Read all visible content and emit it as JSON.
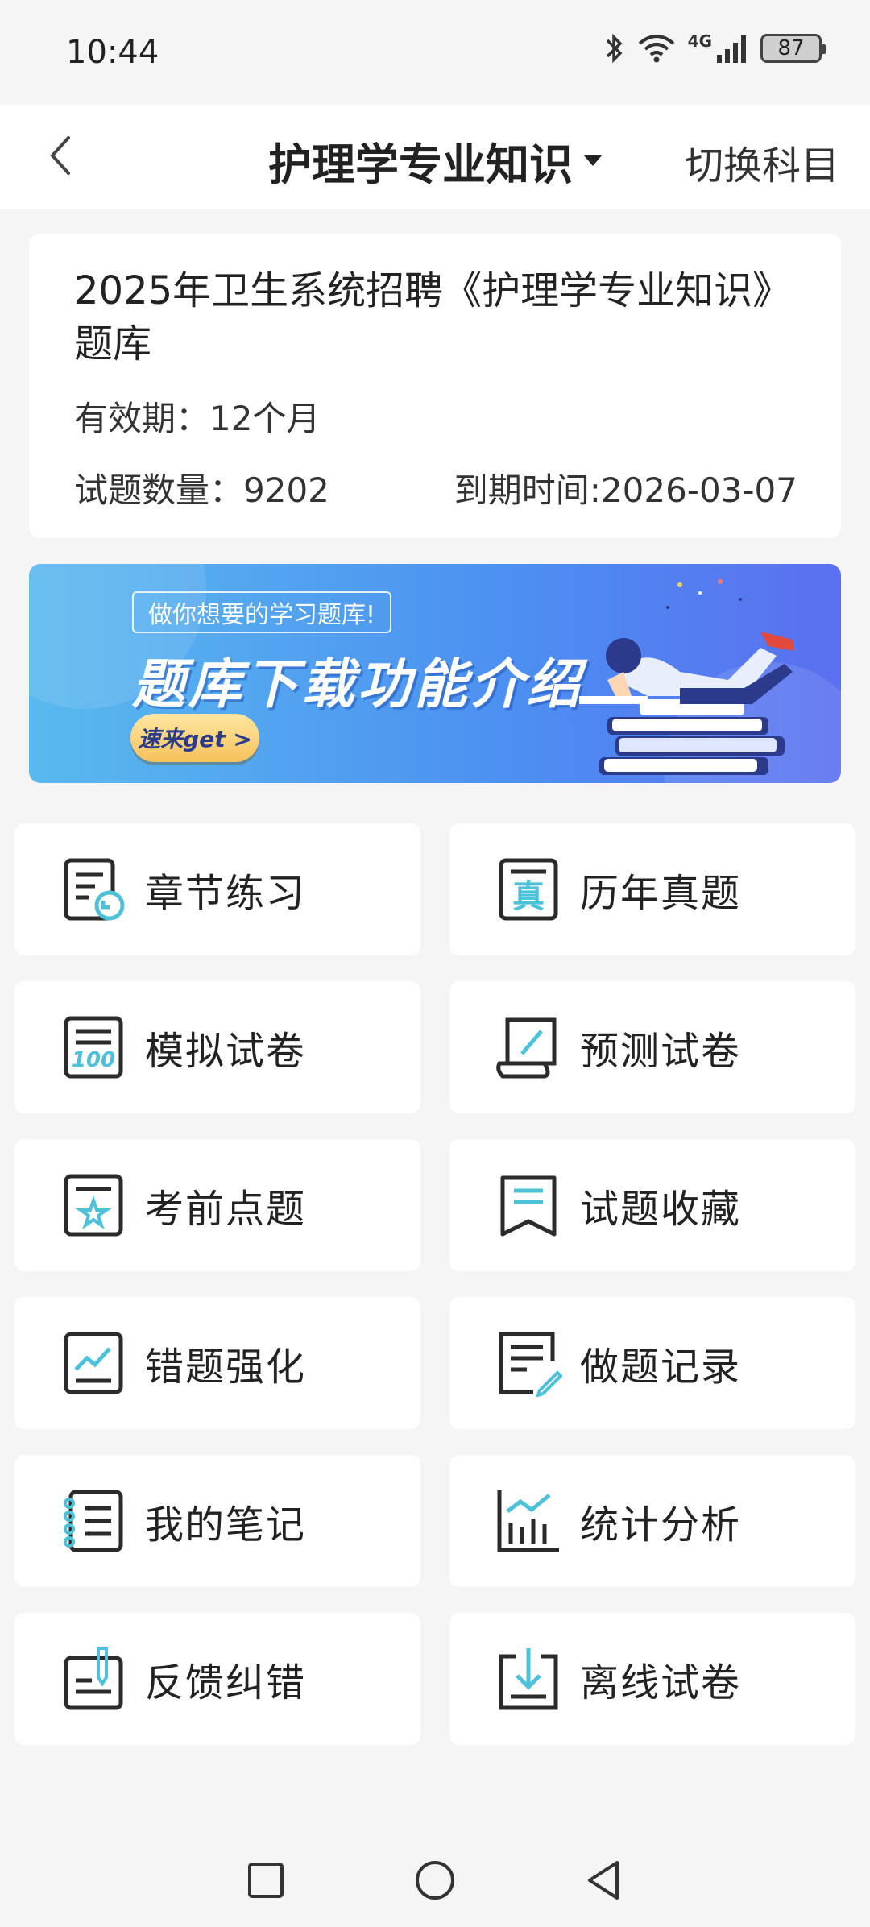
{
  "status_bar": {
    "time": "10:44",
    "network": "4G",
    "battery": "87",
    "icons": [
      "bluetooth-icon",
      "wifi-icon",
      "signal-icon",
      "battery-icon"
    ]
  },
  "header": {
    "back_icon": "chevron-left-icon",
    "title": "护理学专业知识",
    "switch_label": "切换科目"
  },
  "info": {
    "title": "2025年卫生系统招聘《护理学专业知识》题库",
    "validity": "有效期：12个月",
    "question_count": "试题数量：9202",
    "expiry": "到期时间:2026-03-07"
  },
  "banner": {
    "tag": "做你想要的学习题库!",
    "heading": "题库下载功能介绍",
    "button": "速来get >"
  },
  "menu": {
    "items": [
      {
        "label": "章节练习",
        "icon": "chapter-practice-icon"
      },
      {
        "label": "历年真题",
        "icon": "past-exam-icon"
      },
      {
        "label": "模拟试卷",
        "icon": "mock-exam-icon"
      },
      {
        "label": "预测试卷",
        "icon": "forecast-exam-icon"
      },
      {
        "label": "考前点题",
        "icon": "key-points-icon"
      },
      {
        "label": "试题收藏",
        "icon": "bookmark-icon"
      },
      {
        "label": "错题强化",
        "icon": "mistakes-icon"
      },
      {
        "label": "做题记录",
        "icon": "history-icon"
      },
      {
        "label": "我的笔记",
        "icon": "notes-icon"
      },
      {
        "label": "统计分析",
        "icon": "statistics-icon"
      },
      {
        "label": "反馈纠错",
        "icon": "feedback-icon"
      },
      {
        "label": "离线试卷",
        "icon": "download-icon"
      }
    ]
  },
  "colors": {
    "accent": "#4cc1d9",
    "icon_stroke": "#2b2b2b",
    "banner_start": "#59b9ee",
    "banner_end": "#5b6ff0"
  }
}
